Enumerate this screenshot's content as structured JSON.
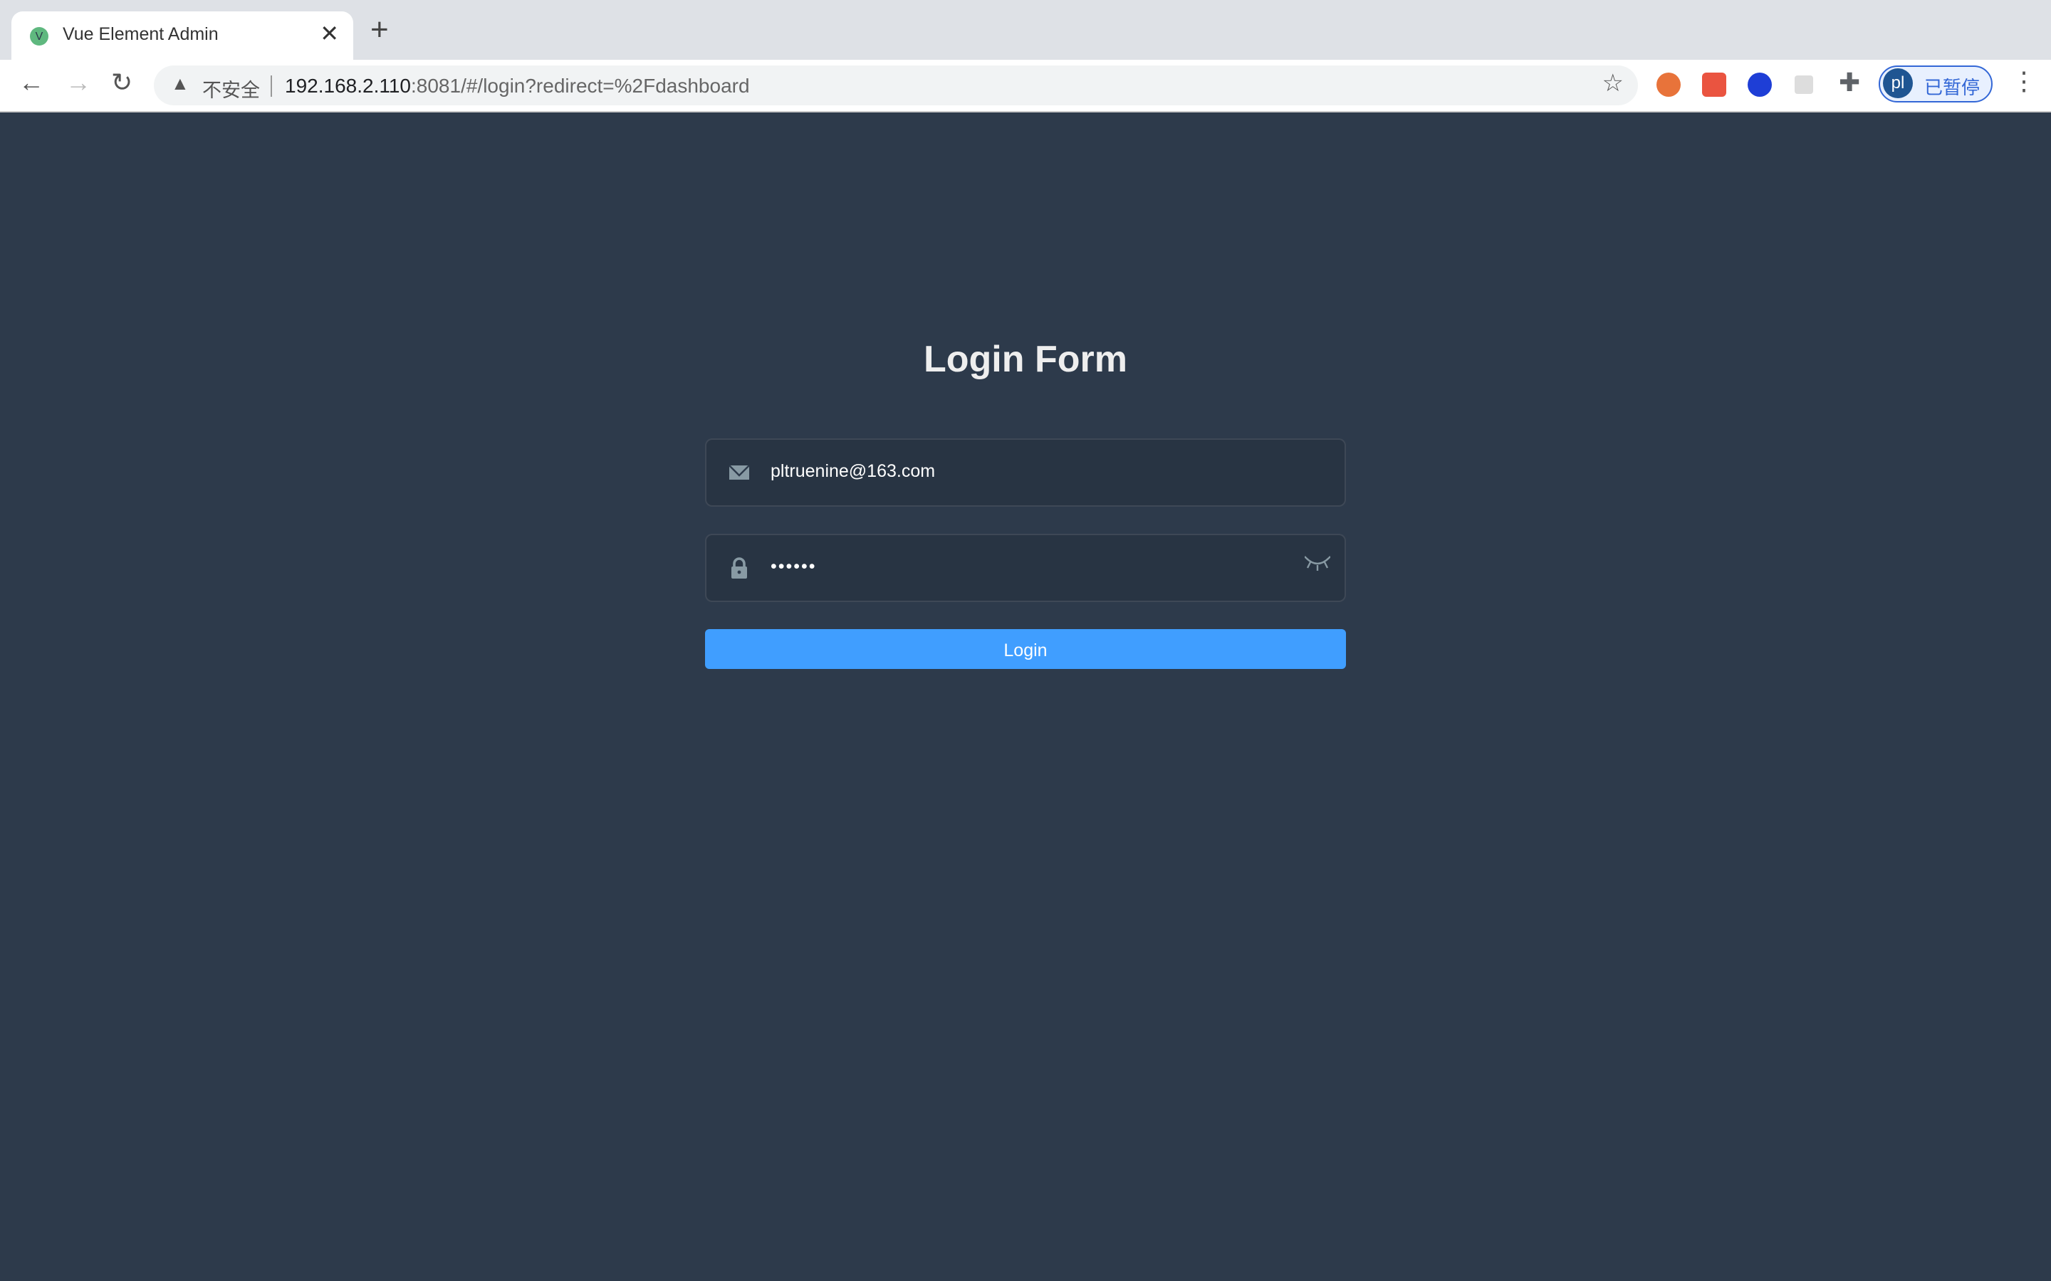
{
  "browser": {
    "tab_title": "Vue Element Admin",
    "favicon_letter": "V",
    "new_tab": "+",
    "close": "✕",
    "security_label": "不安全",
    "url_host": "192.168.2.110",
    "url_rest": ":8081/#/login?redirect=%2Fdashboard",
    "profile_initials": "pl",
    "profile_status": "已暂停"
  },
  "login": {
    "title": "Login Form",
    "username": "pltruenine@163.com",
    "password": "••••••",
    "button": "Login"
  },
  "colors": {
    "background": "#2d3a4b",
    "button": "#409eff"
  }
}
